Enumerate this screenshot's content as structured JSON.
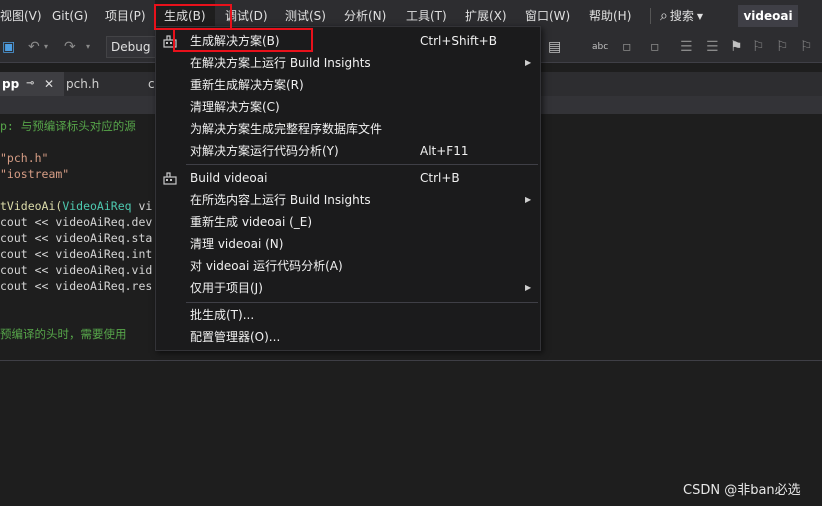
{
  "menubar": {
    "items": [
      {
        "label": "视图(V)"
      },
      {
        "label": "Git(G)"
      },
      {
        "label": "项目(P)"
      },
      {
        "label": "生成(B)"
      },
      {
        "label": "调试(D)"
      },
      {
        "label": "测试(S)"
      },
      {
        "label": "分析(N)"
      },
      {
        "label": "工具(T)"
      },
      {
        "label": "扩展(X)"
      },
      {
        "label": "窗口(W)"
      },
      {
        "label": "帮助(H)"
      }
    ],
    "search_label": "搜索",
    "solution_name": "videoai"
  },
  "toolbar": {
    "config": "Debug"
  },
  "tabs": [
    {
      "label": "pp"
    },
    {
      "label": "pch.h"
    },
    {
      "label": "c"
    }
  ],
  "code": {
    "lines": [
      "p: 与预编译标头对应的源",
      "\"pch.h\"",
      "\"iostream\"",
      "tVideoAi(",
      "VideoAiReq",
      " vi",
      "cout << videoAiReq.dev",
      "cout << videoAiReq.sta",
      "cout << videoAiReq.int",
      "cout << videoAiReq.vid",
      "cout << videoAiReq.res",
      "预编译的头时，需要使用"
    ]
  },
  "build_menu": {
    "items": [
      {
        "label": "生成解决方案(B)",
        "shortcut": "Ctrl+Shift+B"
      },
      {
        "label": "在解决方案上运行 Build Insights"
      },
      {
        "label": "重新生成解决方案(R)"
      },
      {
        "label": "清理解决方案(C)"
      },
      {
        "label": "为解决方案生成完整程序数据库文件"
      },
      {
        "label": "对解决方案运行代码分析(Y)",
        "shortcut": "Alt+F11"
      },
      {
        "label": "Build videoai",
        "shortcut": "Ctrl+B"
      },
      {
        "label": "在所选内容上运行 Build Insights"
      },
      {
        "label": "重新生成 videoai (_E)"
      },
      {
        "label": "清理 videoai (N)"
      },
      {
        "label": "对 videoai 运行代码分析(A)"
      },
      {
        "label": "仅用于项目(J)"
      },
      {
        "label": "批生成(T)..."
      },
      {
        "label": "配置管理器(O)..."
      }
    ]
  },
  "watermark": "CSDN @非ban必选",
  "colors": {
    "highlight_border": "#e8111b",
    "menu_bg": "#1b1b1c",
    "comment": "#57a64a",
    "string": "#d69d85"
  }
}
